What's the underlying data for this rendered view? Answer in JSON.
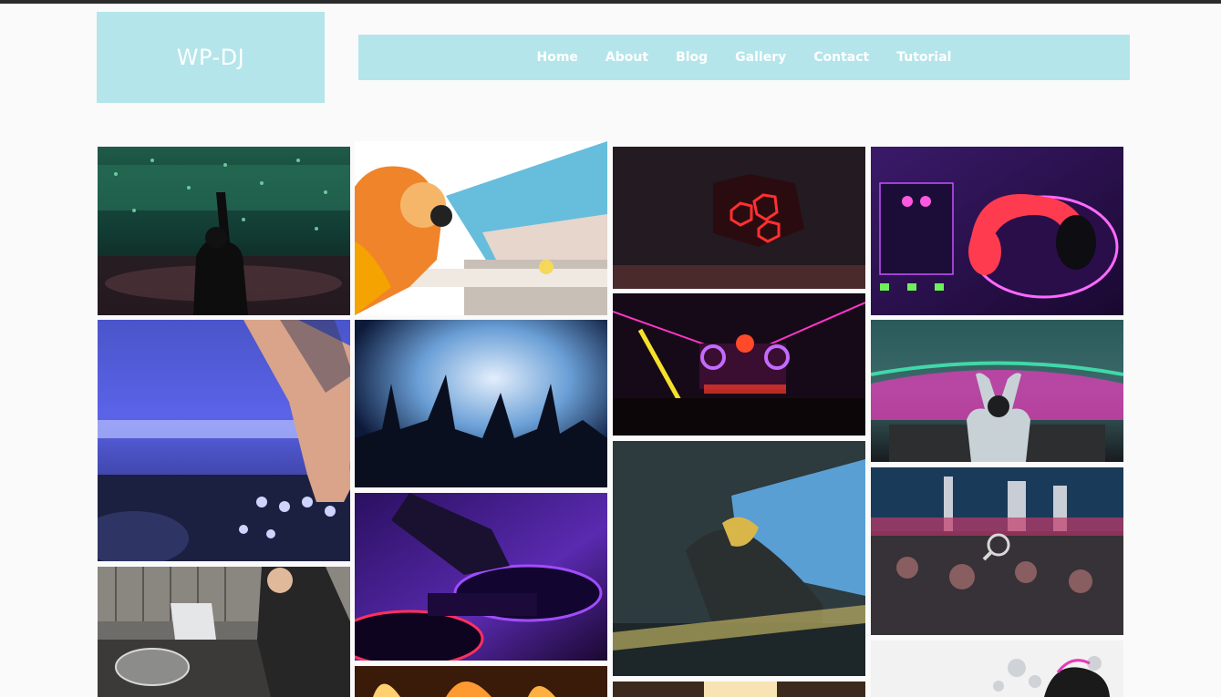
{
  "site": {
    "logo_text": "WP-DJ"
  },
  "nav": {
    "items": [
      "Home",
      "About",
      "Blog",
      "Gallery",
      "Contact",
      "Tutorial"
    ]
  },
  "gallery": {
    "columns": 4,
    "items": [
      {
        "name": "gallery-image-crowd-confetti",
        "hover_icon": "zoom-icon"
      },
      {
        "name": "gallery-image-pool-party-dj"
      },
      {
        "name": "gallery-image-led-helmet"
      },
      {
        "name": "gallery-image-headphones-mixer"
      },
      {
        "name": "gallery-image-tattooed-hand-mixer"
      },
      {
        "name": "gallery-image-smoke-hands"
      },
      {
        "name": "gallery-image-laser-stage"
      },
      {
        "name": "gallery-image-heart-hands-dj"
      },
      {
        "name": "gallery-image-dj-laptop-turntables"
      },
      {
        "name": "gallery-image-purple-turntable"
      },
      {
        "name": "gallery-image-dj-blue-screen"
      },
      {
        "name": "gallery-image-festival-stage-blurred"
      },
      {
        "name": "gallery-image-fire-show"
      },
      {
        "name": "gallery-image-stage-lights"
      },
      {
        "name": "gallery-image-headphones-illustration"
      }
    ]
  },
  "colors": {
    "accent": "#b4e5ea",
    "topbar": "#2b2b2b",
    "background": "#fafafa"
  }
}
